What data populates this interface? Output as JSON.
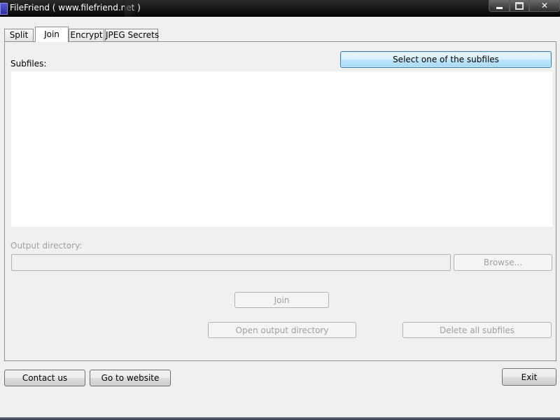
{
  "window": {
    "title": "FileFriend ( www.filefriend.net )",
    "controls": {
      "minimize": "minimize",
      "maximize": "maximize",
      "close": "✕"
    }
  },
  "tabs": [
    {
      "label": "Split",
      "active": false
    },
    {
      "label": "Join",
      "active": true
    },
    {
      "label": "Encrypt",
      "active": false
    },
    {
      "label": "JPEG Secrets",
      "active": false
    }
  ],
  "join_panel": {
    "subfiles_label": "Subfiles:",
    "select_button": "Select one of the subfiles",
    "subfiles_items": [],
    "output_directory_label": "Output directory:",
    "output_directory_value": "",
    "browse_button": "Browse...",
    "join_button": "Join",
    "open_output_button": "Open output directory",
    "delete_all_button": "Delete all subfiles"
  },
  "footer": {
    "contact_button": "Contact us",
    "website_button": "Go to website",
    "exit_button": "Exit"
  },
  "colors": {
    "focused_button": "#bee6fd",
    "titlebar": "#0a0a0a",
    "disabled_text": "#a0a0a0"
  }
}
